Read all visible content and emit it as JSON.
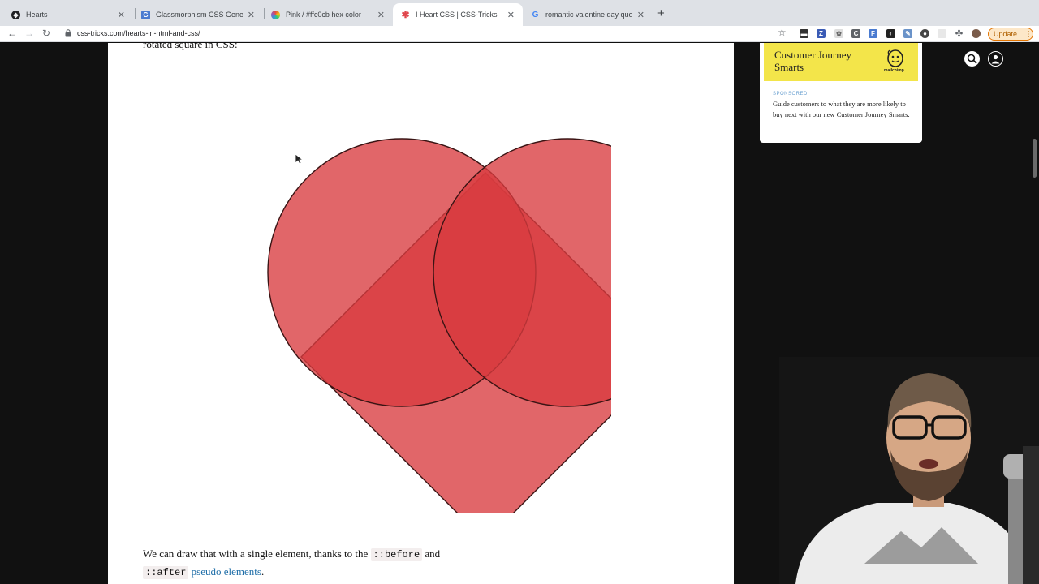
{
  "browser": {
    "tabs": [
      {
        "title": "Hearts",
        "icon": "codepen-icon",
        "favicon_color": "#202124",
        "active": false
      },
      {
        "title": "Glassmorphism CSS Generator",
        "icon": "generator-icon",
        "favicon_color": "#4a7bd0",
        "active": false
      },
      {
        "title": "Pink / #ffc0cb hex color",
        "icon": "color-wheel-icon",
        "favicon_color": "#5f6368",
        "active": false
      },
      {
        "title": "I Heart CSS | CSS-Tricks",
        "icon": "asterisk-icon",
        "favicon_color": "#e0464c",
        "active": true
      },
      {
        "title": "romantic valentine day quote",
        "icon": "google-icon",
        "favicon_color": "#4285f4",
        "active": false
      }
    ],
    "url": "css-tricks.com/hearts-in-html-and-css/",
    "update_label": "Update"
  },
  "article": {
    "intro_text": "rotated square in CSS:",
    "para_part1": "We can draw that with a single element, thanks to the",
    "code_before": "::before",
    "para_and": "and",
    "code_after": "::after",
    "link_text": "pseudo elements",
    "para_end": "."
  },
  "sidebar_ad": {
    "banner_title": "Customer Journey Smarts",
    "logo_text": "mailchimp",
    "sponsored_label": "SPONSORED",
    "body": "Guide customers to what they are more likely to buy next with our new Customer Journey Smarts."
  },
  "colors": {
    "heart_fill": "#d93b3f",
    "ad_banner": "#f3e54a",
    "link": "#1f6ea8",
    "update_accent": "#e37400"
  }
}
